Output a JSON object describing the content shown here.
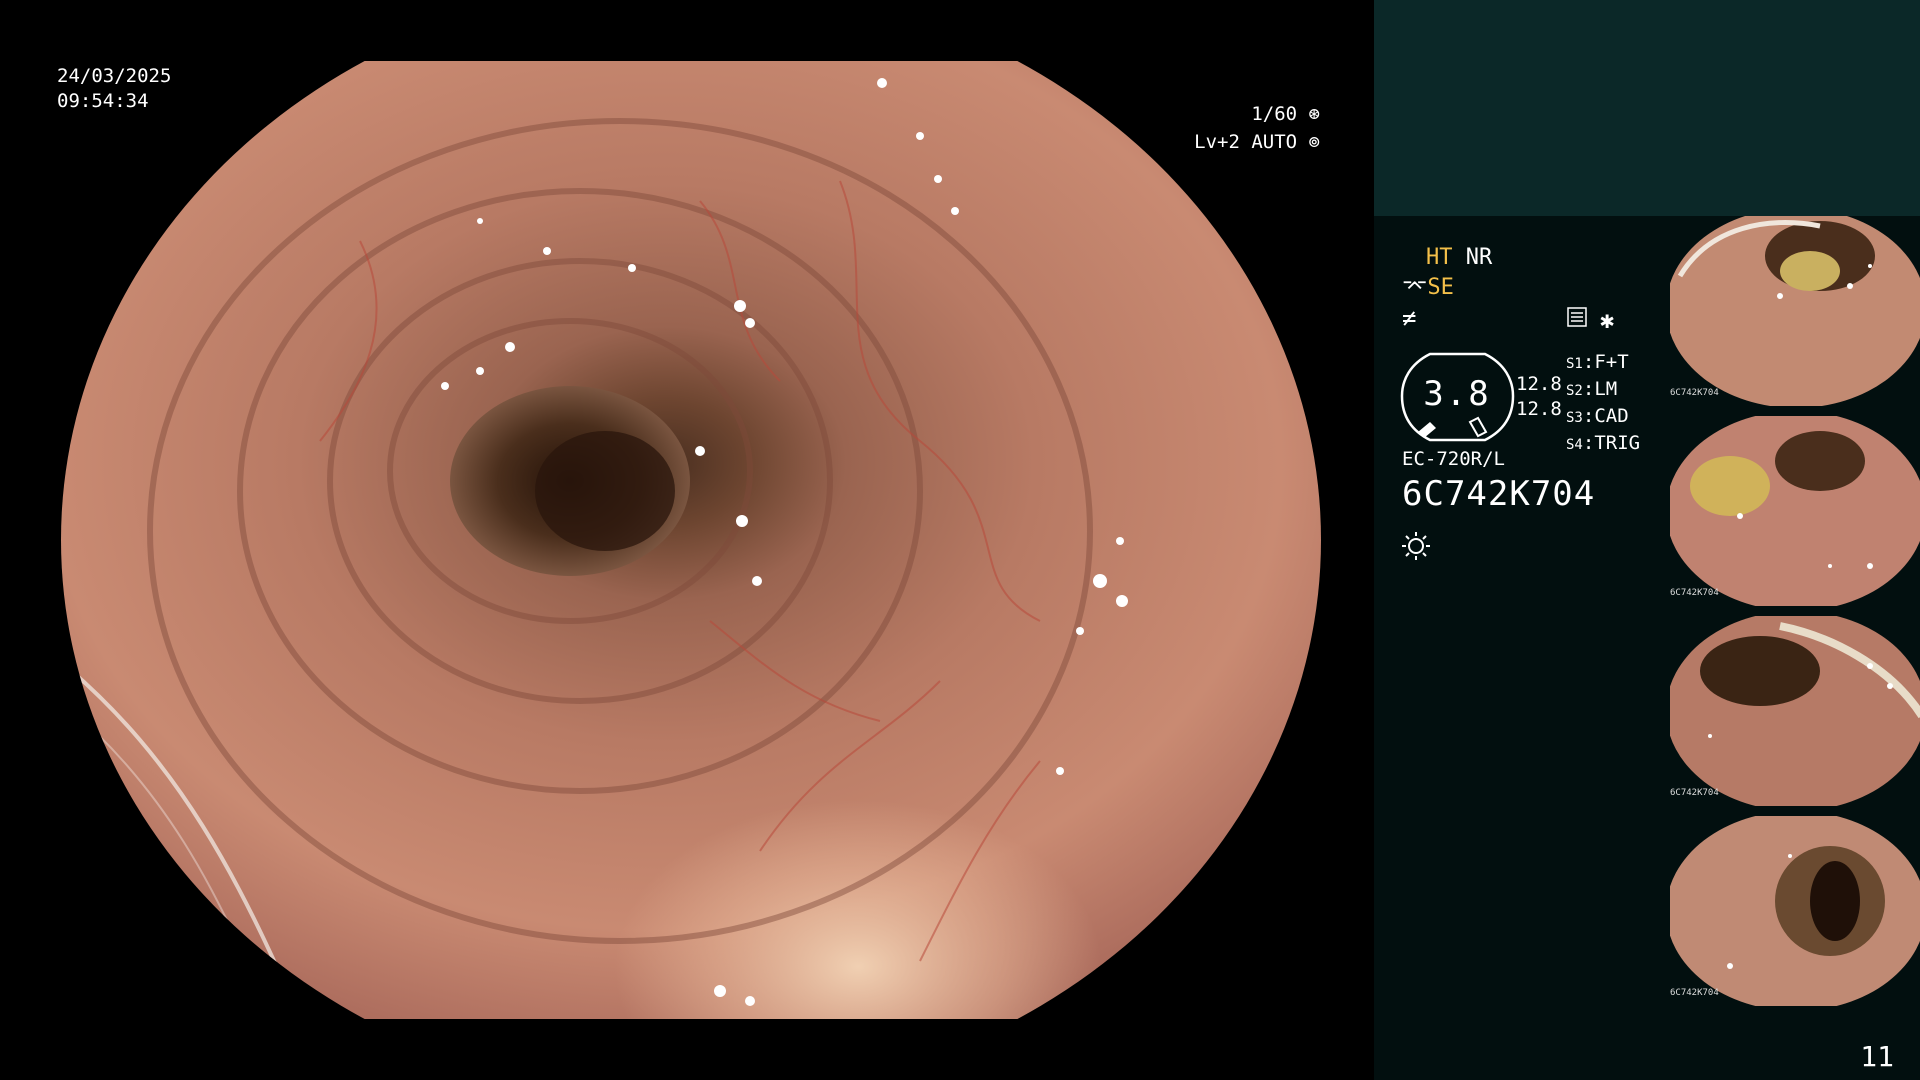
{
  "main_view": {
    "date": "24/03/2025",
    "time": "09:54:34",
    "shutter": "1/60",
    "level": "Lv+2 AUTO"
  },
  "status": {
    "ht": "HT",
    "nr": "NR",
    "se": "SE"
  },
  "gauge": {
    "value": "3.8",
    "left_values": [
      "12.8",
      "12.8"
    ]
  },
  "switches": [
    {
      "key": "S1",
      "value": "F+T"
    },
    {
      "key": "S2",
      "value": "LM"
    },
    {
      "key": "S3",
      "value": "CAD"
    },
    {
      "key": "S4",
      "value": "TRIG"
    }
  ],
  "scope": {
    "model": "EC-720R/L",
    "serial": "6C742K704"
  },
  "thumbnails": [
    {
      "label": "6C742K704"
    },
    {
      "label": "6C742K704"
    },
    {
      "label": "6C742K704"
    },
    {
      "label": "6C742K704"
    }
  ],
  "page_number": "11",
  "colors": {
    "panel_top": "#0b2828",
    "panel": "#020f0f",
    "accent_yellow": "#f4c04a",
    "tissue": "#c98a72"
  },
  "icons": [
    "shutter-icon",
    "auto-iris-icon",
    "scope-tip-icon",
    "flash-icon",
    "grid-icon",
    "star-icon",
    "light-icon"
  ]
}
